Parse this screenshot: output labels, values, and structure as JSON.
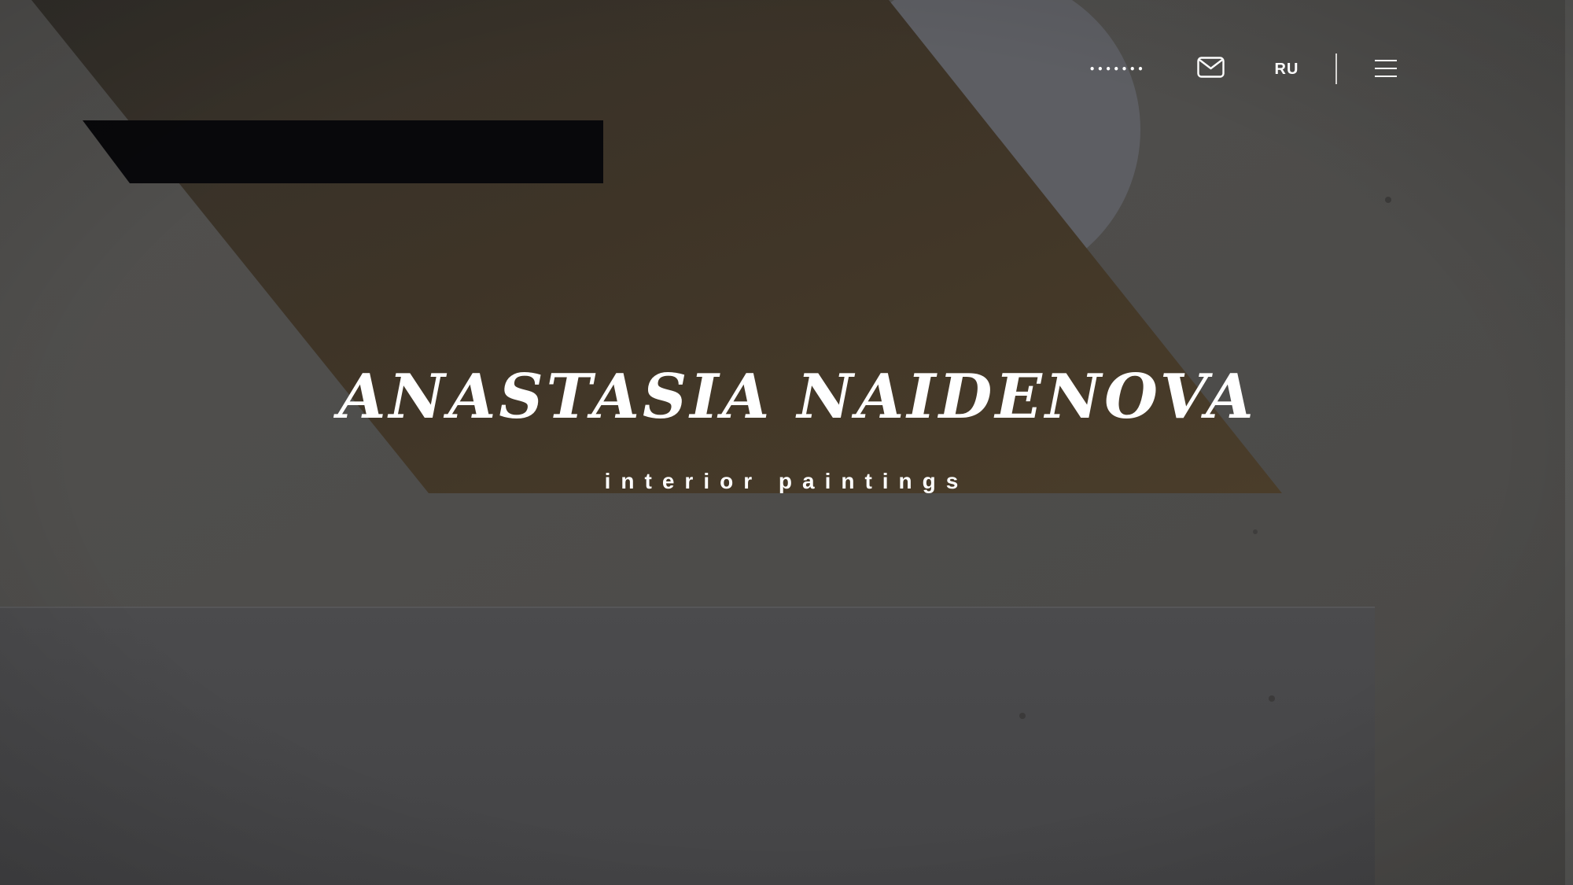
{
  "header": {
    "phone": "•••••••",
    "mail_icon": "envelope-icon",
    "language": "RU",
    "menu_icon": "hamburger-menu-icon"
  },
  "hero": {
    "title": "ANASTASIA NAIDENOVA",
    "subtitle": "interior paintings"
  },
  "colors": {
    "background": "#4f4d4b",
    "ochre_shape": "#3a3024",
    "black_bar": "#08080b",
    "light_circle": "#5e5f64",
    "lower_panel": "#4a4a4c",
    "text": "#ffffff"
  }
}
